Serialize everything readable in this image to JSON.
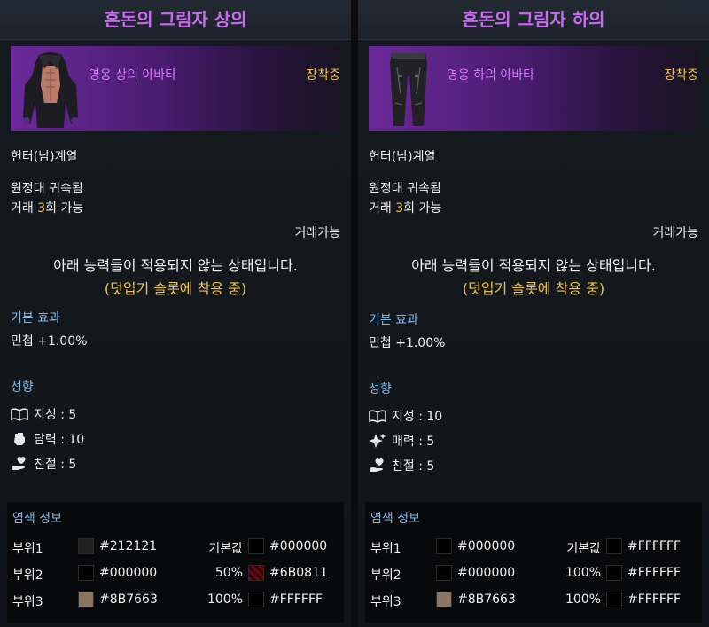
{
  "panels": [
    {
      "title": "혼돈의 그림자 상의",
      "avatar_label": "영웅 상의 아바타",
      "equip_status": "장착중",
      "class_req": "헌터(남)계열",
      "bound": "원정대 귀속됨",
      "trade_prefix": "거래 ",
      "trade_count": "3",
      "trade_suffix": "회 가능",
      "tradeable": "거래가능",
      "notice": "아래 능력들이 적용되지 않는 상태입니다.",
      "notice_sub": "(덧입기 슬롯에 착용 중)",
      "basic_effect_title": "기본 효과",
      "basic_effect": "민첩 +1.00%",
      "tendency_title": "성향",
      "tendencies": [
        {
          "icon": "book-icon",
          "text": "지성 : 5"
        },
        {
          "icon": "fist-icon",
          "text": "담력 : 10"
        },
        {
          "icon": "heart-hand-icon",
          "text": "친절 : 5"
        }
      ],
      "dye_title": "염색 정보",
      "dye_rows": [
        {
          "part": "부위1",
          "color": "#212121",
          "hex": "#212121",
          "pct": "기본값",
          "color2": "#000000",
          "hex2": "#000000"
        },
        {
          "part": "부위2",
          "color": "#000000",
          "hex": "#000000",
          "pct": "50%",
          "color2": "#6B0811",
          "hex2": "#6B0811",
          "pattern2": true
        },
        {
          "part": "부위3",
          "color": "#8B7663",
          "hex": "#8B7663",
          "pct": "100%",
          "color2": "#000000",
          "hex2": "#FFFFFF"
        }
      ]
    },
    {
      "title": "혼돈의 그림자 하의",
      "avatar_label": "영웅 하의 아바타",
      "equip_status": "장착중",
      "class_req": "헌터(남)계열",
      "bound": "원정대 귀속됨",
      "trade_prefix": "거래 ",
      "trade_count": "3",
      "trade_suffix": "회 가능",
      "tradeable": "거래가능",
      "notice": "아래 능력들이 적용되지 않는 상태입니다.",
      "notice_sub": "(덧입기 슬롯에 착용 중)",
      "basic_effect_title": "기본 효과",
      "basic_effect": "민첩 +1.00%",
      "tendency_title": "성향",
      "tendencies": [
        {
          "icon": "book-icon",
          "text": "지성 : 10"
        },
        {
          "icon": "sparkle-icon",
          "text": "매력 : 5"
        },
        {
          "icon": "heart-hand-icon",
          "text": "친절 : 5"
        }
      ],
      "dye_title": "염색 정보",
      "dye_rows": [
        {
          "part": "부위1",
          "color": "#000000",
          "hex": "#000000",
          "pct": "기본값",
          "color2": "#000000",
          "hex2": "#FFFFFF"
        },
        {
          "part": "부위2",
          "color": "#000000",
          "hex": "#000000",
          "pct": "100%",
          "color2": "#000000",
          "hex2": "#FFFFFF"
        },
        {
          "part": "부위3",
          "color": "#8B7663",
          "hex": "#8B7663",
          "pct": "100%",
          "color2": "#000000",
          "hex2": "#FFFFFF"
        }
      ]
    }
  ],
  "colors": {
    "title": "#c86bf0",
    "gold": "#f0c44a",
    "section": "#86b8e6"
  }
}
